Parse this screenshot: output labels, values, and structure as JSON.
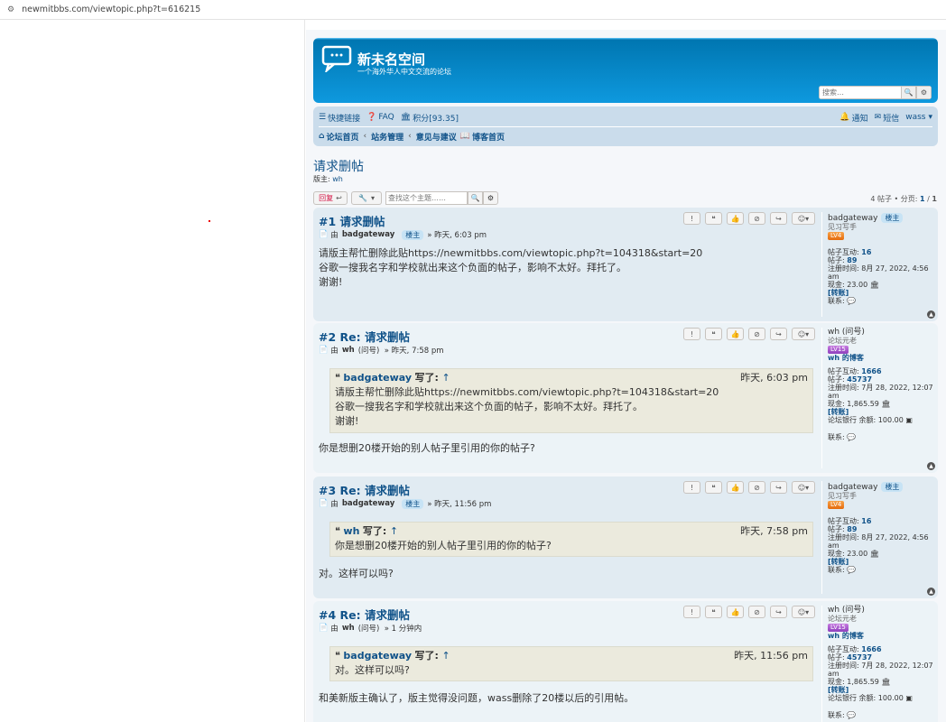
{
  "browser": {
    "url": "newmitbbs.com/viewtopic.php?t=616215"
  },
  "site": {
    "title": "新未名空间",
    "description": "一个海外华人中文交流的论坛",
    "search_placeholder": "搜索…"
  },
  "nav": {
    "quicklinks": "快捷链接",
    "faq": "FAQ",
    "points": "积分[93.35]",
    "notifications": "通知",
    "messages": "短信",
    "user": "wass"
  },
  "breadcrumbs": [
    "论坛首页",
    "站务管理",
    "意见与建议",
    "博客首页"
  ],
  "topic": {
    "title": "请求删帖",
    "moderators_label": "版主:",
    "moderator": "wh"
  },
  "actions": {
    "reply": "回复",
    "search_placeholder": "查找这个主题……",
    "pagination_count": "4 帖子 • 分页:",
    "page": "1",
    "of": "/",
    "total": "1"
  },
  "posts": [
    {
      "num": "#1",
      "title": "请求删帖",
      "by": "由",
      "author": "badgateway",
      "author_badge": "楼主",
      "time": "» 昨天, 6:03 pm",
      "body": [
        "请版主帮忙删除此贴https://newmitbbs.com/viewtopic.php?t=104318&start=20",
        "谷歌一搜我名字和学校就出来这个负面的帖子，影响不太好。拜托了。",
        "谢谢!"
      ],
      "side": {
        "name": "badgateway",
        "badge": "楼主",
        "rank": "见习写手",
        "lv": "LV4",
        "l1": "帖子互动:",
        "v1": "16",
        "l2": "帖子:",
        "v2": "89",
        "l3": "注册时间:",
        "v3": "8月 27, 2022, 4:56 am",
        "l4": "现金:",
        "v4": "23.00",
        "transfer": "[转账]",
        "contact": "联系:"
      }
    },
    {
      "num": "#2",
      "title": "Re: 请求删帖",
      "by": "由",
      "author": "wh",
      "author_extra": "(问号)",
      "time": "» 昨天, 7:58 pm",
      "quote": {
        "name": "badgateway",
        "wrote": "写了:",
        "arrow": "↑",
        "time": "昨天, 6:03 pm",
        "lines": [
          "请版主帮忙删除此贴https://newmitbbs.com/viewtopic.php?t=104318&start=20",
          "谷歌一搜我名字和学校就出来这个负面的帖子，影响不太好。拜托了。",
          "谢谢!"
        ]
      },
      "body": [
        "你是想删20楼开始的别人帖子里引用的你的帖子?"
      ],
      "side": {
        "name": "wh (问号)",
        "rank": "论坛元老",
        "lv": "LV15",
        "blog": "wh 的博客",
        "l1": "帖子互动:",
        "v1": "1666",
        "l2": "帖子:",
        "v2": "45737",
        "l3": "注册时间:",
        "v3": "7月 28, 2022, 12:07 am",
        "l4": "现金:",
        "v4": "1,865.59",
        "transfer": "[转账]",
        "bank": "论坛银行 余额:",
        "bankval": "100.00",
        "contact": "联系:"
      }
    },
    {
      "num": "#3",
      "title": "Re: 请求删帖",
      "by": "由",
      "author": "badgateway",
      "author_badge": "楼主",
      "time": "» 昨天, 11:56 pm",
      "quote": {
        "name": "wh",
        "wrote": "写了:",
        "arrow": "↑",
        "time": "昨天, 7:58 pm",
        "lines": [
          "你是想删20楼开始的别人帖子里引用的你的帖子?"
        ]
      },
      "body": [
        "对。这样可以吗?"
      ],
      "side": {
        "name": "badgateway",
        "badge": "楼主",
        "rank": "见习写手",
        "lv": "LV4",
        "l1": "帖子互动:",
        "v1": "16",
        "l2": "帖子:",
        "v2": "89",
        "l3": "注册时间:",
        "v3": "8月 27, 2022, 4:56 am",
        "l4": "现金:",
        "v4": "23.00",
        "transfer": "[转账]",
        "contact": "联系:"
      }
    },
    {
      "num": "#4",
      "title": "Re: 请求删帖",
      "by": "由",
      "author": "wh",
      "author_extra": "(问号)",
      "time": "» 1 分钟内",
      "quote": {
        "name": "badgateway",
        "wrote": "写了:",
        "arrow": "↑",
        "time": "昨天, 11:56 pm",
        "lines": [
          "对。这样可以吗?"
        ]
      },
      "body": [
        "和美新版主确认了，版主觉得没问题，wass删除了20楼以后的引用帖。"
      ],
      "side": {
        "name": "wh (问号)",
        "rank": "论坛元老",
        "lv": "LV15",
        "blog": "wh 的博客",
        "l1": "帖子互动:",
        "v1": "1666",
        "l2": "帖子:",
        "v2": "45737",
        "l3": "注册时间:",
        "v3": "7月 28, 2022, 12:07 am",
        "l4": "现金:",
        "v4": "1,865.59",
        "transfer": "[转账]",
        "bank": "论坛银行 余额:",
        "bankval": "100.00",
        "contact": "联系:"
      }
    }
  ]
}
